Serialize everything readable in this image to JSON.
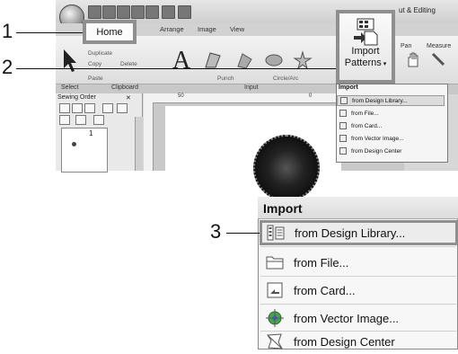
{
  "callouts": [
    "1",
    "2",
    "3"
  ],
  "app": {
    "title_partial": "ut & Editing",
    "tabs": [
      "Arrange",
      "Image",
      "View"
    ],
    "home_tab": "Home",
    "clipboard_items": [
      "Duplicate",
      "Copy",
      "Delete",
      "Paste"
    ],
    "group_labels": [
      "Select",
      "Clipboard",
      "Input",
      "Import"
    ],
    "input_labels": [
      "Punch",
      "Circle/Arc"
    ],
    "import_button": [
      "Import",
      "Patterns"
    ],
    "other_tools": [
      "Pan",
      "Measure"
    ],
    "panel_title": "Sewing Order",
    "panel_close": "✕",
    "thumb_number": "1",
    "ruler_marks": [
      "50",
      "0"
    ]
  },
  "menu": {
    "header": "Import",
    "items": [
      {
        "label": "from Design Library...",
        "icon": "design-library-icon",
        "highlighted": true
      },
      {
        "label": "from File...",
        "icon": "folder-icon",
        "highlighted": false
      },
      {
        "label": "from Card...",
        "icon": "card-icon",
        "highlighted": false
      },
      {
        "label": "from Vector Image...",
        "icon": "vector-image-icon",
        "highlighted": false
      },
      {
        "label": "from Design Center",
        "icon": "design-center-icon",
        "highlighted": false
      }
    ]
  }
}
